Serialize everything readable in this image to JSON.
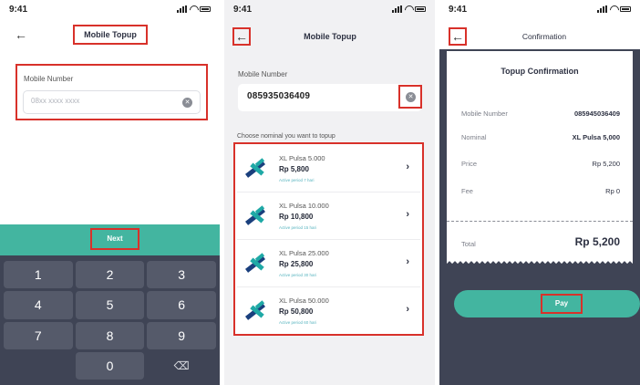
{
  "colors": {
    "accent": "#43b5a0",
    "keypad": "#3f4455",
    "highlight": "#d8312a",
    "period_text": "#5ab5c0"
  },
  "screen1": {
    "time": "9:41",
    "back_icon": "arrow-left-icon",
    "title": "Mobile Topup",
    "mobile_label": "Mobile Number",
    "mobile_placeholder": "08xx xxxx xxxx",
    "next_label": "Next",
    "keys": [
      "1",
      "2",
      "3",
      "4",
      "5",
      "6",
      "7",
      "8",
      "9",
      "",
      "0",
      "⌫"
    ]
  },
  "screen2": {
    "time": "9:41",
    "title": "Mobile Topup",
    "mobile_label": "Mobile Number",
    "mobile_value": "085935036409",
    "choose_label": "Choose nominal you want to topup",
    "items": [
      {
        "name": "XL Pulsa 5.000",
        "price": "Rp 5,800",
        "period": "Active period 7 hari"
      },
      {
        "name": "XL Pulsa 10.000",
        "price": "Rp 10,800",
        "period": "Active period 15 hari"
      },
      {
        "name": "XL Pulsa 25.000",
        "price": "Rp 25,800",
        "period": "Active period 30 hari"
      },
      {
        "name": "XL Pulsa 50.000",
        "price": "Rp 50,800",
        "period": "Active period 60 hari"
      }
    ]
  },
  "screen3": {
    "time": "9:41",
    "title": "Confirmation",
    "receipt_title": "Topup Confirmation",
    "rows": [
      {
        "label": "Mobile Number",
        "value": "085945036409"
      },
      {
        "label": "Nominal",
        "value": "XL Pulsa 5,000"
      },
      {
        "label": "Price",
        "value": "Rp 5,200"
      },
      {
        "label": "Fee",
        "value": "Rp 0"
      }
    ],
    "total_label": "Total",
    "total_value": "Rp 5,200",
    "pay_label": "Pay"
  }
}
